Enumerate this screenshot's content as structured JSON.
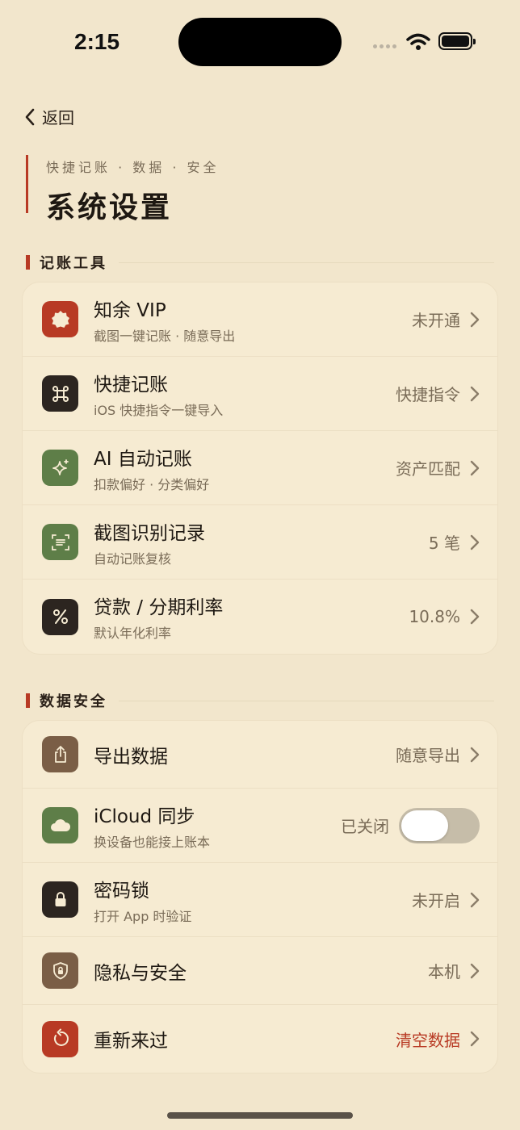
{
  "status": {
    "time": "2:15"
  },
  "nav": {
    "back_label": "返回"
  },
  "header": {
    "subtitle": "快捷记账 · 数据 · 安全",
    "title": "系统设置"
  },
  "colors": {
    "accent": "#b83a24",
    "background": "#f2e6cc",
    "card": "#f6ebd2",
    "green": "#5e7e48",
    "dark": "#2c2520",
    "brown": "#7a5e46"
  },
  "sections": [
    {
      "title": "记账工具",
      "items": [
        {
          "title": "知余 VIP",
          "desc": "截图一键记账 · 随意导出",
          "value": "未开通",
          "icon": "badge-icon"
        },
        {
          "title": "快捷记账",
          "desc": "iOS 快捷指令一键导入",
          "value": "快捷指令",
          "icon": "command-icon"
        },
        {
          "title": "AI 自动记账",
          "desc": "扣款偏好 · 分类偏好",
          "value": "资产匹配",
          "icon": "sparkle-icon"
        },
        {
          "title": "截图识别记录",
          "desc": "自动记账复核",
          "value": "5 笔",
          "icon": "scan-text-icon"
        },
        {
          "title": "贷款 / 分期利率",
          "desc": "默认年化利率",
          "value": "10.8%",
          "icon": "percent-icon"
        }
      ]
    },
    {
      "title": "数据安全",
      "items": [
        {
          "title": "导出数据",
          "desc": "",
          "value": "随意导出",
          "icon": "share-icon"
        },
        {
          "title": "iCloud 同步",
          "desc": "换设备也能接上账本",
          "value": "已关闭",
          "icon": "cloud-icon",
          "toggle_on": false
        },
        {
          "title": "密码锁",
          "desc": "打开 App 时验证",
          "value": "未开启",
          "icon": "lock-icon"
        },
        {
          "title": "隐私与安全",
          "desc": "",
          "value": "本机",
          "icon": "shield-lock-icon"
        },
        {
          "title": "重新来过",
          "desc": "",
          "value": "清空数据",
          "icon": "reset-icon"
        }
      ]
    }
  ]
}
